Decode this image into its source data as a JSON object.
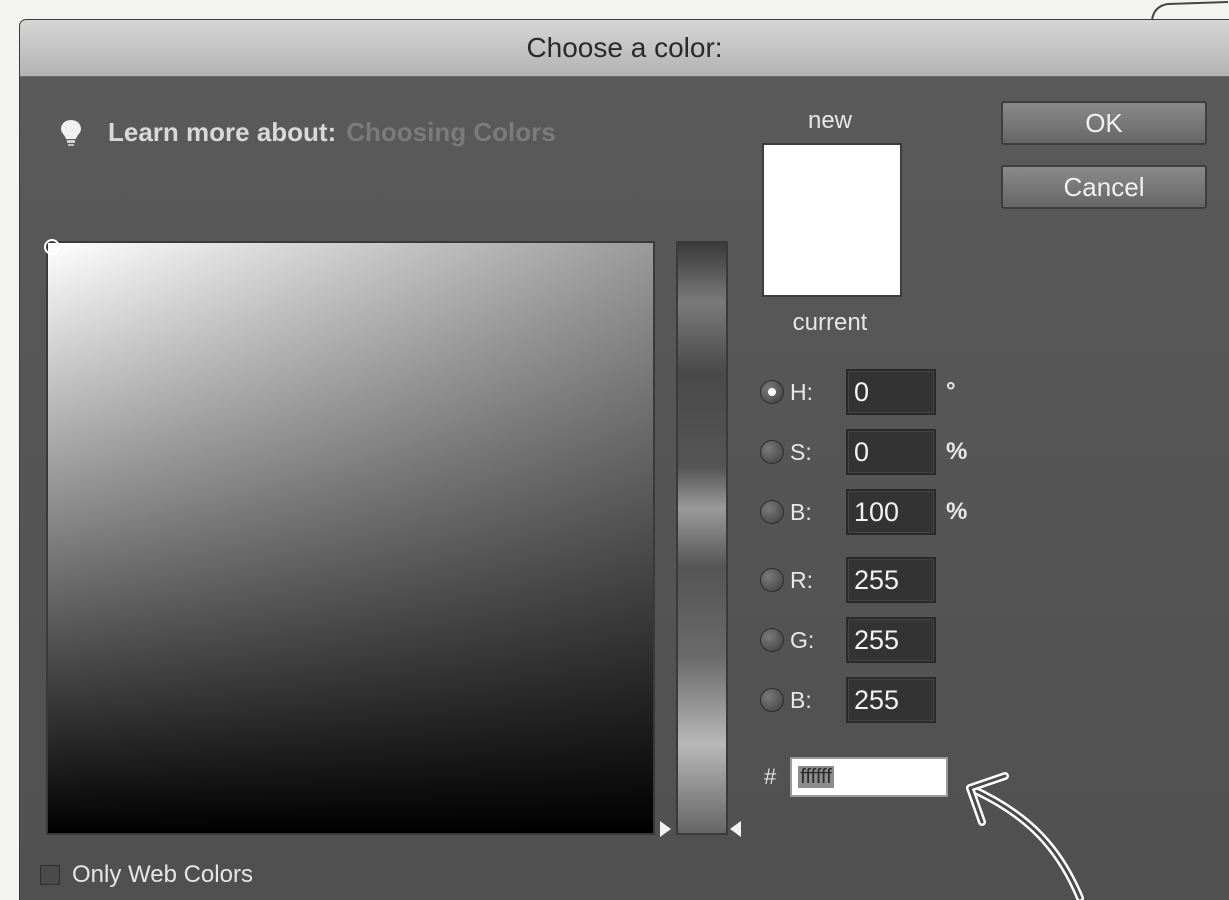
{
  "window": {
    "title": "Choose a color:"
  },
  "learn_more": {
    "label": "Learn more about:",
    "link_text": "Choosing Colors"
  },
  "preview": {
    "new_label": "new",
    "current_label": "current",
    "swatch_color": "#ffffff"
  },
  "buttons": {
    "ok": "OK",
    "cancel": "Cancel"
  },
  "fields": {
    "h": {
      "label": "H:",
      "value": "0",
      "unit": "°",
      "selected": true
    },
    "s": {
      "label": "S:",
      "value": "0",
      "unit": "%"
    },
    "b": {
      "label": "B:",
      "value": "100",
      "unit": "%"
    },
    "r": {
      "label": "R:",
      "value": "255"
    },
    "g": {
      "label": "G:",
      "value": "255"
    },
    "blue": {
      "label": "B:",
      "value": "255"
    }
  },
  "hex": {
    "symbol": "#",
    "value": "ffffff"
  },
  "web_colors": {
    "label": "Only Web Colors",
    "checked": false
  },
  "icons": {
    "learn": "lightbulb-icon",
    "annotation": "hand-drawn-arrow"
  }
}
